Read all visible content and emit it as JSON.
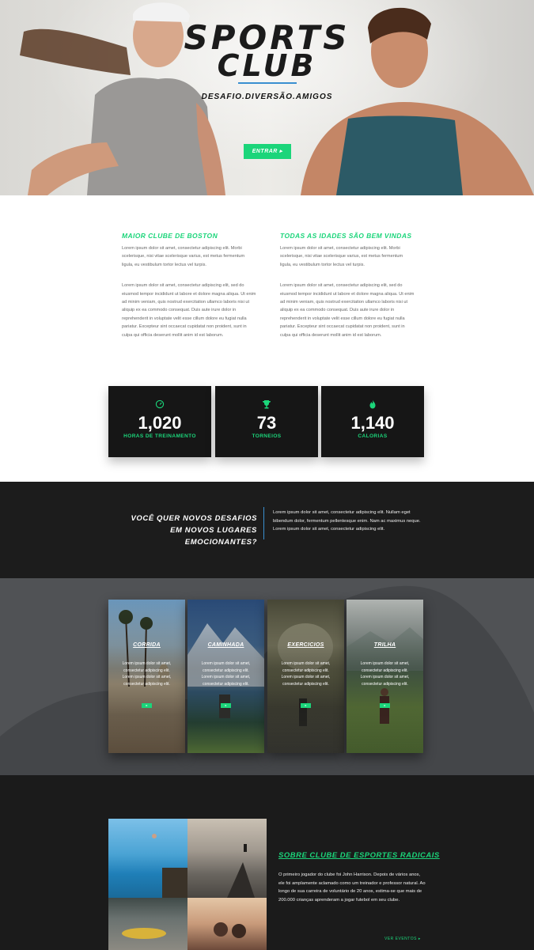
{
  "hero": {
    "title_line1": "SPORTS",
    "title_line2": "CLUB",
    "tagline": "DESAFIO.DIVERSÃO.AMIGOS",
    "button_label": "ENTRAR ▸"
  },
  "intro": {
    "left": {
      "heading": "MAIOR CLUBE DE BOSTON",
      "p1": "Lorem ipsum dolor sit amet, consectetur adipiscing elit. Morbi scelerisque, nisi vitae scelerisque varius, est metus fermentum ligula, eu vestibulum tortor lectus vel turpis.",
      "p2": "Lorem ipsum dolor sit amet, consectetur adipiscing elit, sed do eiusmod tempor incididunt ut labore et dolore magna aliqua. Ut enim ad minim veniam, quis nostrud exercitation ullamco laboris nisi ut aliquip ex ea commodo consequat. Duis aute irure dolor in reprehenderit in voluptate velit esse cillum dolore eu fugiat nulla pariatur. Excepteur sint occaecat cupidatat non proident, sunt in culpa qui officia deserunt mollit anim id est laborum."
    },
    "right": {
      "heading": "TODAS AS IDADES SÃO BEM VINDAS",
      "p1": "Lorem ipsum dolor sit amet, consectetur adipiscing elit. Morbi scelerisque, nisi vitae scelerisque varius, est metus fermentum ligula, eu vestibulum tortor lectus vel turpis.",
      "p2": "Lorem ipsum dolor sit amet, consectetur adipiscing elit, sed do eiusmod tempor incididunt ut labore et dolore magna aliqua. Ut enim ad minim veniam, quis nostrud exercitation ullamco laboris nisi ut aliquip ex ea commodo consequat. Duis aute irure dolor in reprehenderit in voluptate velit esse cillum dolore eu fugiat nulla pariatur. Excepteur sint occaecat cupidatat non proident, sunt in culpa qui officia deserunt mollit anim id est laborum."
    }
  },
  "stats": [
    {
      "icon": "speedometer-icon",
      "value": "1,020",
      "label": "HORAS DE TREINAMENTO"
    },
    {
      "icon": "trophy-icon",
      "value": "73",
      "label": "TORNEIOS"
    },
    {
      "icon": "flame-icon",
      "value": "1,140",
      "label": "CALORIAS"
    }
  ],
  "challenge": {
    "question": "VOCÊ QUER NOVOS DESAFIOS EM NOVOS LUGARES EMOCIONANTES?",
    "text": "Lorem ipsum dolor sit amet, consectetur adipiscing elit. Nullam eget bibendum dolor, fermentum pellentesque enim. Nam ac maximus neque. Lorem ipsum dolor sit amet, consectetur adipiscing elit."
  },
  "cards": [
    {
      "title": "CORRIDA",
      "text": "Lorem ipsum dolor sit amet, consectetur adipiscing elit. Lorem ipsum dolor sit amet, consectetur adipiscing elit.",
      "button": "▸"
    },
    {
      "title": "CAMINHADA",
      "text": "Lorem ipsum dolor sit amet, consectetur adipiscing elit. Lorem ipsum dolor sit amet, consectetur adipiscing elit.",
      "button": "▸"
    },
    {
      "title": "EXERCICIOS",
      "text": "Lorem ipsum dolor sit amet, consectetur adipiscing elit. Lorem ipsum dolor sit amet, consectetur adipiscing elit.",
      "button": "▸"
    },
    {
      "title": "TRILHA",
      "text": "Lorem ipsum dolor sit amet, consectetur adipiscing elit. Lorem ipsum dolor sit amet, consectetur adipiscing elit.",
      "button": "▸"
    }
  ],
  "about": {
    "heading": "SOBRE CLUBE DE ESPORTES RADICAIS",
    "text": "O primeiro jogador do clube foi John Harrison. Depois de vários anos, ele foi amplamente aclamado como um treinador e professor natural. Ao longo de sua carreira de voluntário de 20 anos, estima-se que mais de 200.000 crianças aprenderam a jogar futebol em seu clube.",
    "link": "VER EVENTOS ▸"
  },
  "colors": {
    "accent": "#1bd57a",
    "rule": "#3a8fd0",
    "dark": "#1b1b1b"
  }
}
